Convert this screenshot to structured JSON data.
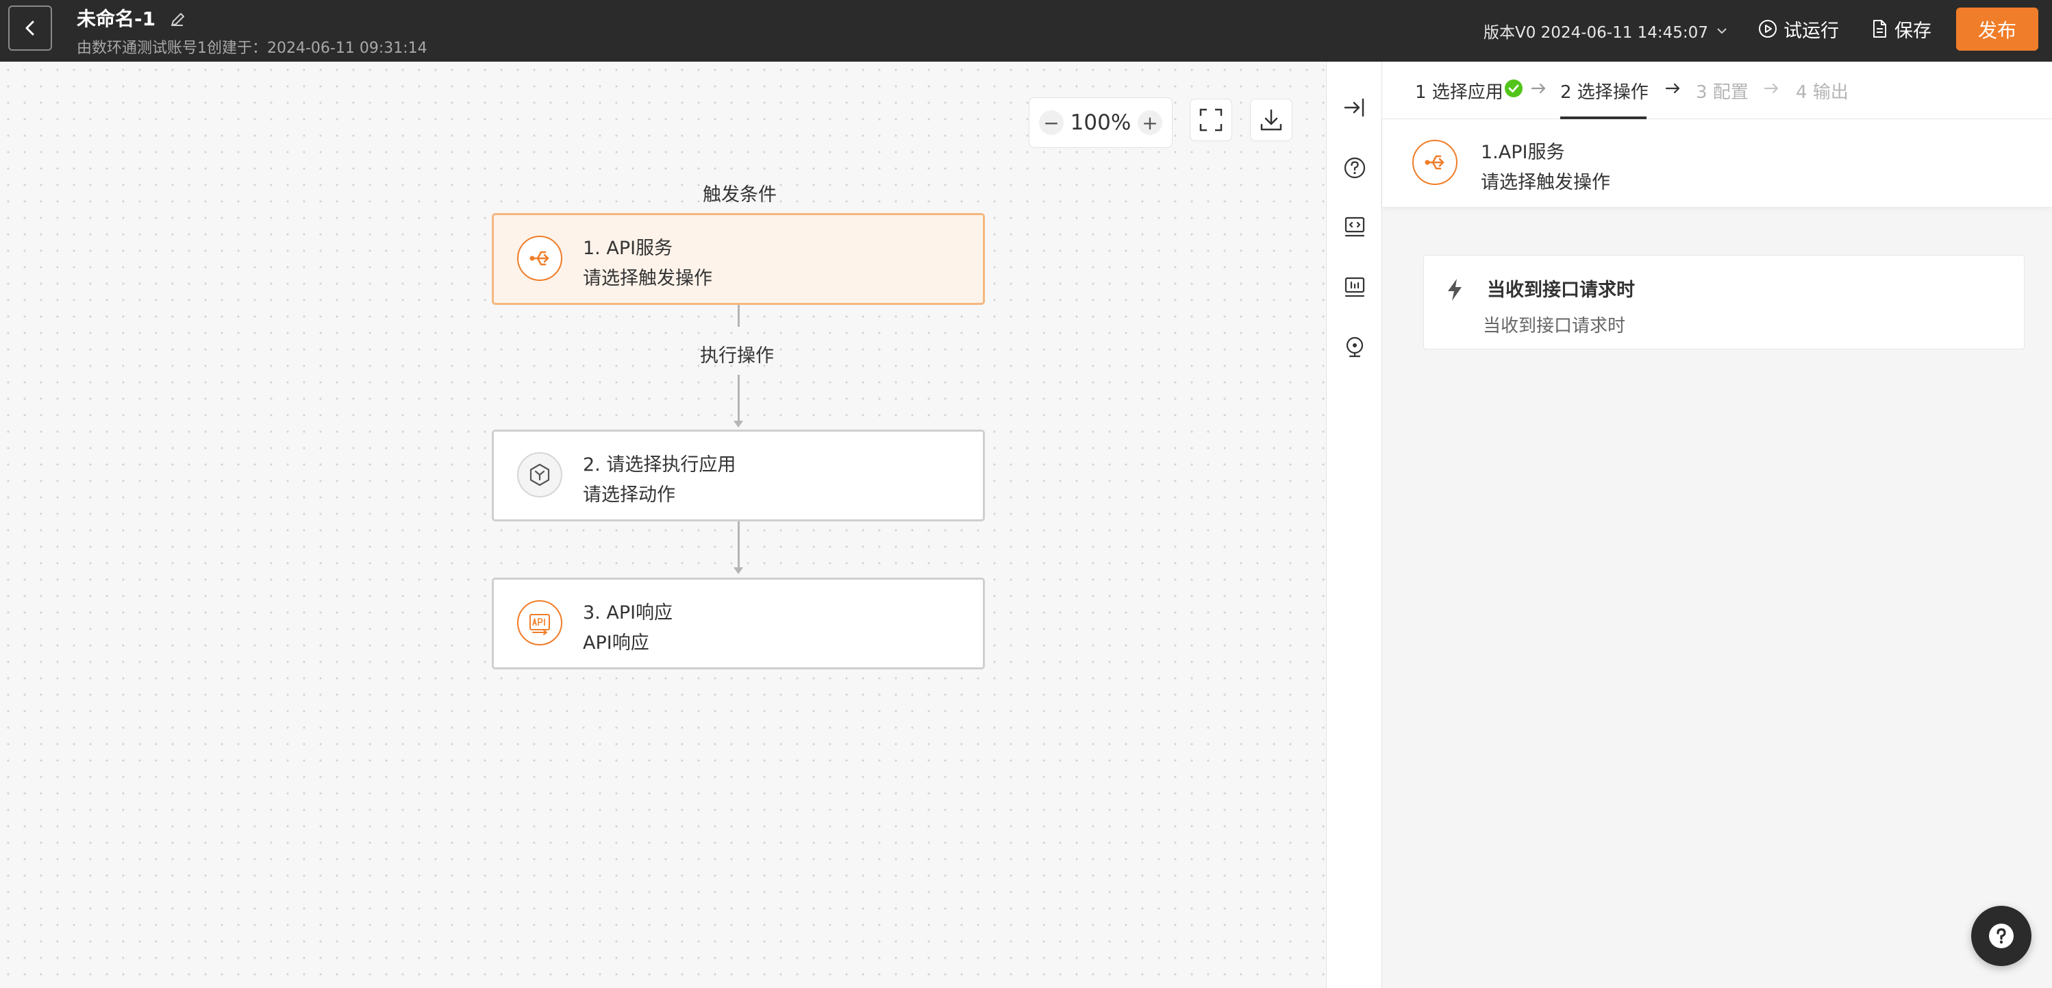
{
  "header": {
    "title": "未命名-1",
    "subtitle": "由数环通测试账号1创建于：2024-06-11 09:31:14",
    "version": "版本V0 2024-06-11 14:45:07",
    "trial_label": "试运行",
    "save_label": "保存",
    "publish_label": "发布"
  },
  "canvas": {
    "zoom": "100%",
    "zoom_out": "−",
    "zoom_in": "+",
    "trigger_section": "触发条件",
    "action_section": "执行操作",
    "nodes": [
      {
        "title": "1. API服务",
        "subtitle": "请选择触发操作",
        "icon": "api-service-icon"
      },
      {
        "title": "2. 请选择执行应用",
        "subtitle": "请选择动作",
        "icon": "app-cube-icon"
      },
      {
        "title": "3. API响应",
        "subtitle": "API响应",
        "icon": "api-response-icon"
      }
    ]
  },
  "panel": {
    "steps": [
      {
        "label": "1 选择应用",
        "state": "done"
      },
      {
        "label": "2 选择操作",
        "state": "current"
      },
      {
        "label": "3 配置",
        "state": "todo"
      },
      {
        "label": "4 输出",
        "state": "todo"
      }
    ],
    "app": {
      "title": "1.API服务",
      "subtitle": "请选择触发操作"
    },
    "trigger": {
      "title": "当收到接口请求时",
      "subtitle": "当收到接口请求时"
    }
  },
  "colors": {
    "accent": "#f07d29",
    "header_bg": "#2b2b2b",
    "success": "#52c41a"
  }
}
